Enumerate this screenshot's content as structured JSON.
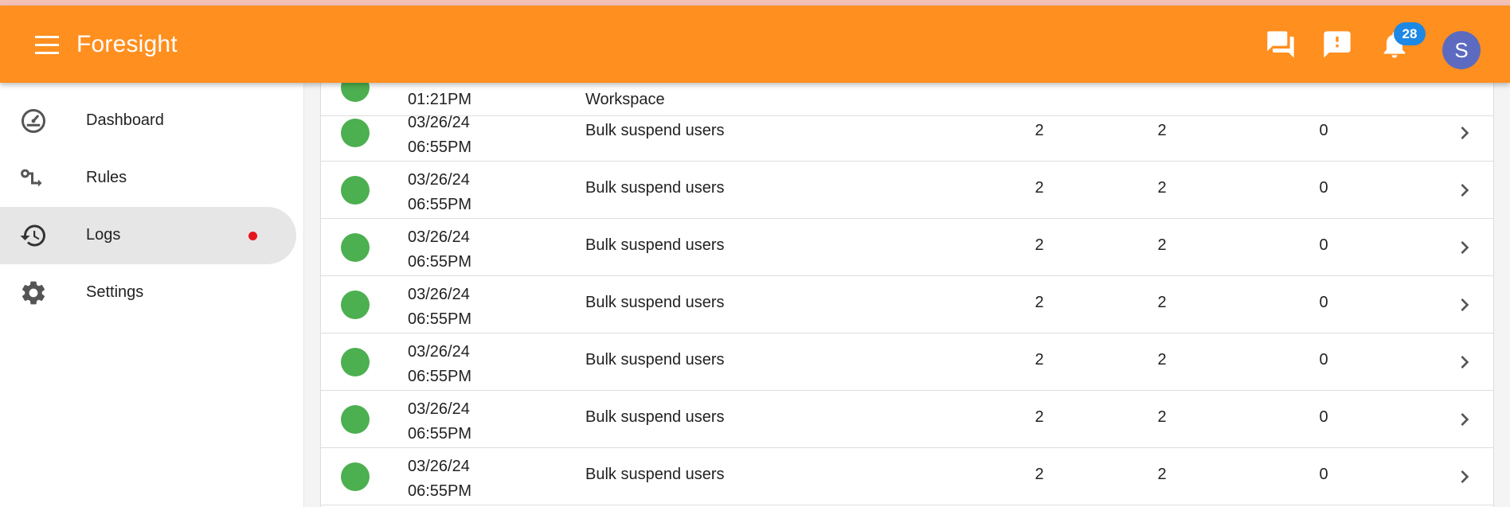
{
  "header": {
    "title": "Foresight",
    "notification_count": "28",
    "avatar_initial": "S"
  },
  "sidebar": {
    "items": [
      {
        "label": "Dashboard",
        "icon": "speedometer-icon"
      },
      {
        "label": "Rules",
        "icon": "rules-icon"
      },
      {
        "label": "Logs",
        "icon": "history-icon",
        "active": true,
        "has_indicator": true
      },
      {
        "label": "Settings",
        "icon": "gear-icon"
      }
    ]
  },
  "logs": {
    "partial_row": {
      "time": "01:21PM",
      "action": "Workspace"
    },
    "rows": [
      {
        "date": "03/26/24",
        "time": "06:55PM",
        "action": "Bulk suspend users",
        "col1": "2",
        "col2": "2",
        "col3": "0"
      },
      {
        "date": "03/26/24",
        "time": "06:55PM",
        "action": "Bulk suspend users",
        "col1": "2",
        "col2": "2",
        "col3": "0"
      },
      {
        "date": "03/26/24",
        "time": "06:55PM",
        "action": "Bulk suspend users",
        "col1": "2",
        "col2": "2",
        "col3": "0"
      },
      {
        "date": "03/26/24",
        "time": "06:55PM",
        "action": "Bulk suspend users",
        "col1": "2",
        "col2": "2",
        "col3": "0"
      },
      {
        "date": "03/26/24",
        "time": "06:55PM",
        "action": "Bulk suspend users",
        "col1": "2",
        "col2": "2",
        "col3": "0"
      },
      {
        "date": "03/26/24",
        "time": "06:55PM",
        "action": "Bulk suspend users",
        "col1": "2",
        "col2": "2",
        "col3": "0"
      },
      {
        "date": "03/26/24",
        "time": "06:55PM",
        "action": "Bulk suspend users",
        "col1": "2",
        "col2": "2",
        "col3": "0"
      }
    ]
  },
  "colors": {
    "accent": "#ff8f1f",
    "status_success": "#4caf50",
    "badge": "#1e88e5",
    "avatar": "#5c6bc0",
    "indicator": "#e5161b"
  }
}
